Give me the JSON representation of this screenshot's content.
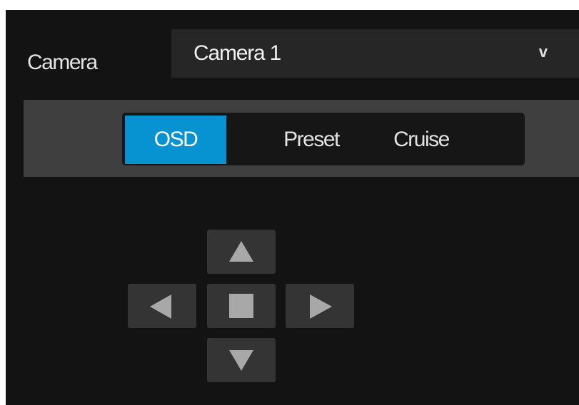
{
  "camera": {
    "label": "Camera",
    "selected": "Camera 1",
    "dropdown_icon": "chevron-down-icon"
  },
  "tabs": [
    {
      "label": "OSD",
      "active": true
    },
    {
      "label": "Preset",
      "active": false
    },
    {
      "label": "Cruise",
      "active": false
    }
  ],
  "ptz": {
    "buttons": [
      "up-arrow-icon",
      "left-arrow-icon",
      "stop-square-icon",
      "right-arrow-icon",
      "down-arrow-icon"
    ]
  },
  "colors": {
    "background": "#131313",
    "select_background": "#262626",
    "tab_bar": "#3f3f3f",
    "active_tab": "#0792d2",
    "button": "#343434",
    "icon": "#a8a8a8"
  }
}
